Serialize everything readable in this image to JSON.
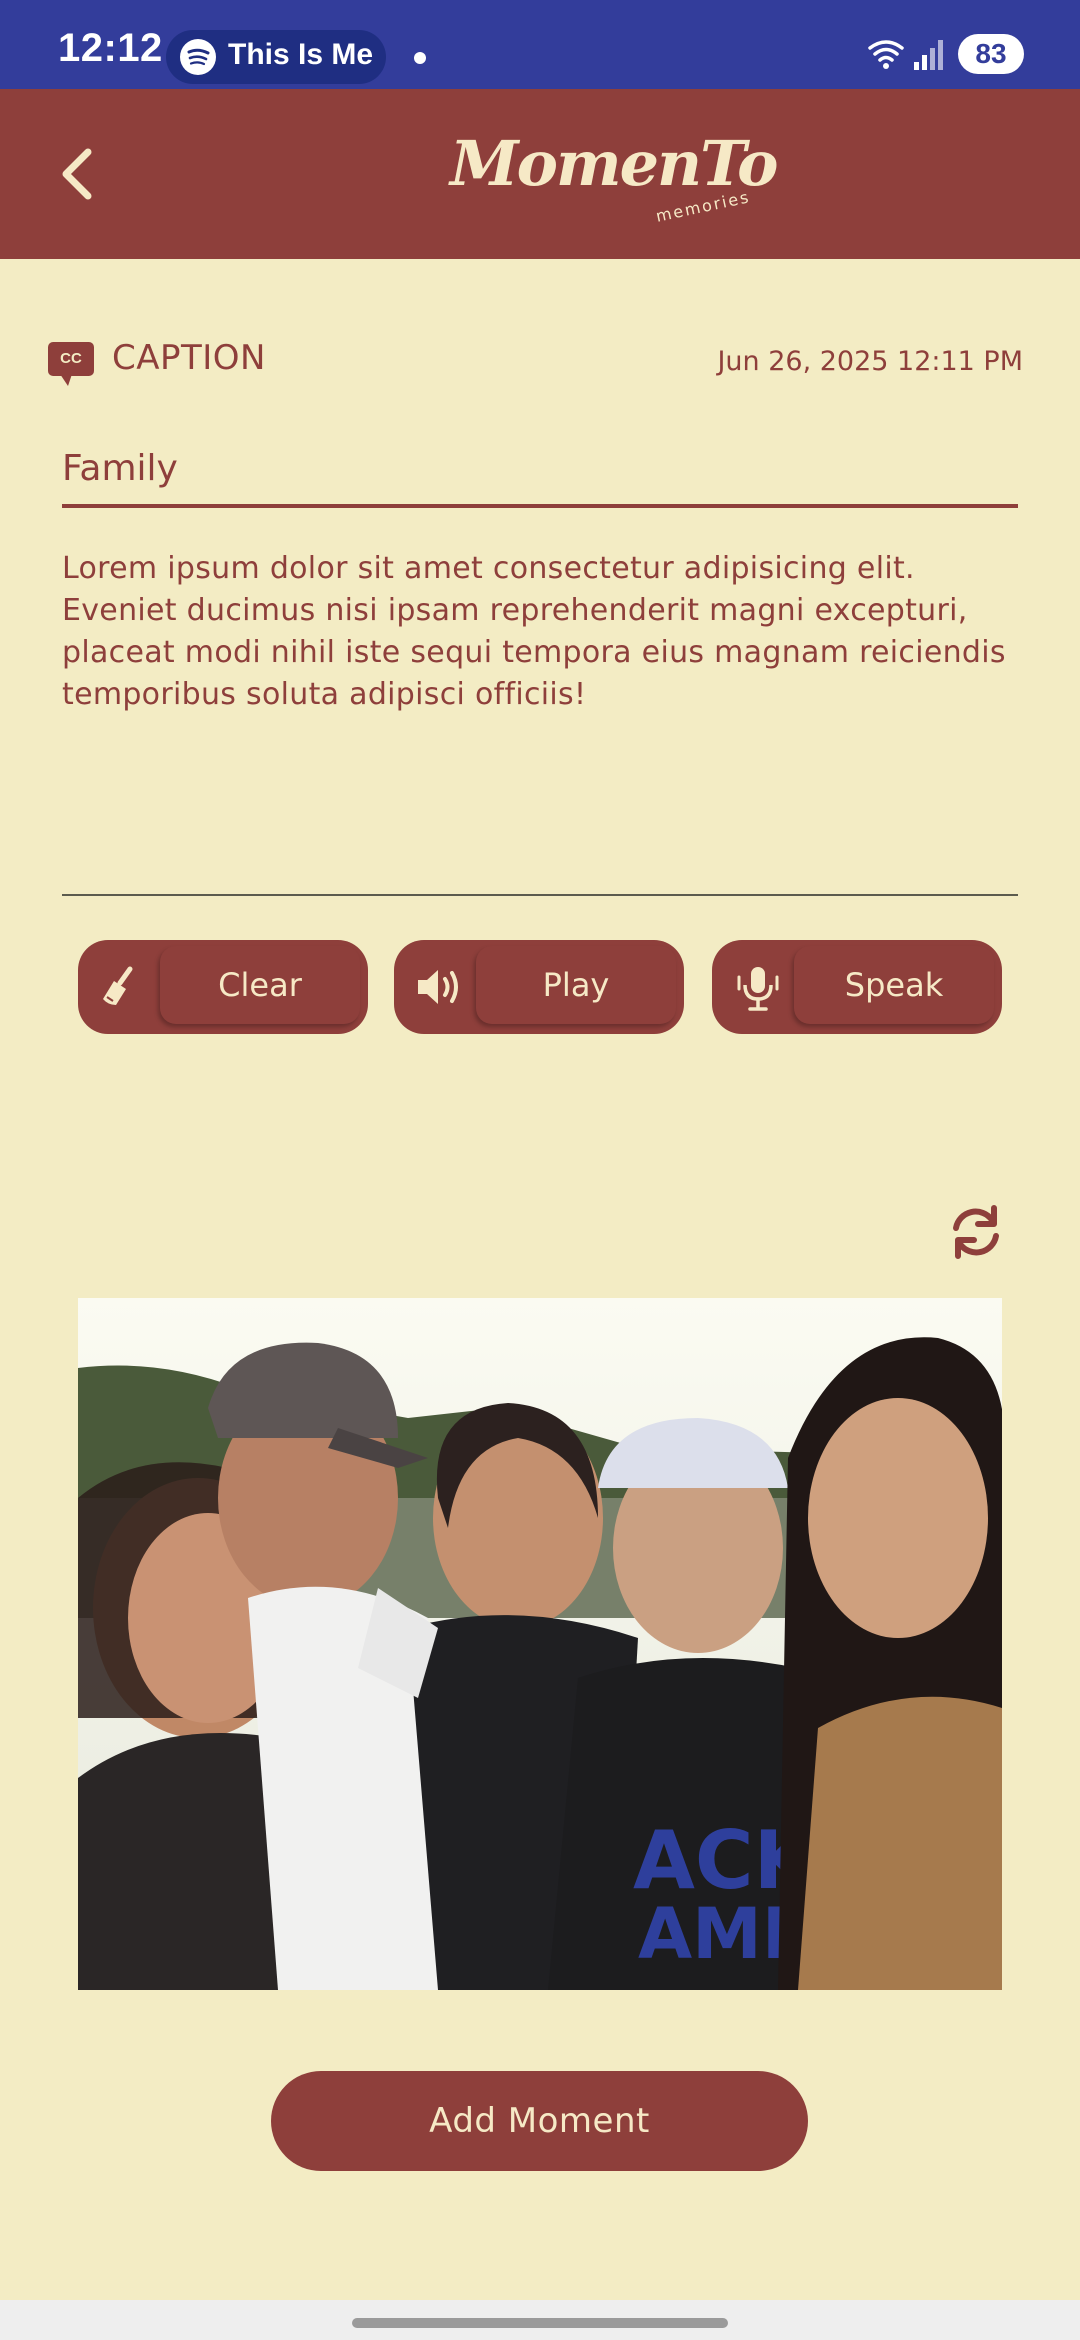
{
  "status_bar": {
    "time": "12:12",
    "media_title": "This Is Me",
    "battery": "83"
  },
  "app_bar": {
    "logo_text": "MomenTo",
    "logo_sub": "memories"
  },
  "caption": {
    "label": "CAPTION",
    "icon_text": "CC",
    "date": "Jun 26, 2025 12:11 PM"
  },
  "form": {
    "title_value": "Family",
    "body_value": "Lorem ipsum dolor sit amet consectetur adipisicing elit. Eveniet ducimus nisi ipsam reprehenderit magni excepturi, placeat modi nihil iste sequi tempora eius magnam reiciendis temporibus soluta adipisci officiis!"
  },
  "actions": {
    "clear_label": "Clear",
    "play_label": "Play",
    "speak_label": "Speak"
  },
  "add_moment_label": "Add Moment",
  "colors": {
    "primary": "#8e3f3b",
    "background": "#f3ecc4",
    "status_bar": "#333d9b"
  }
}
